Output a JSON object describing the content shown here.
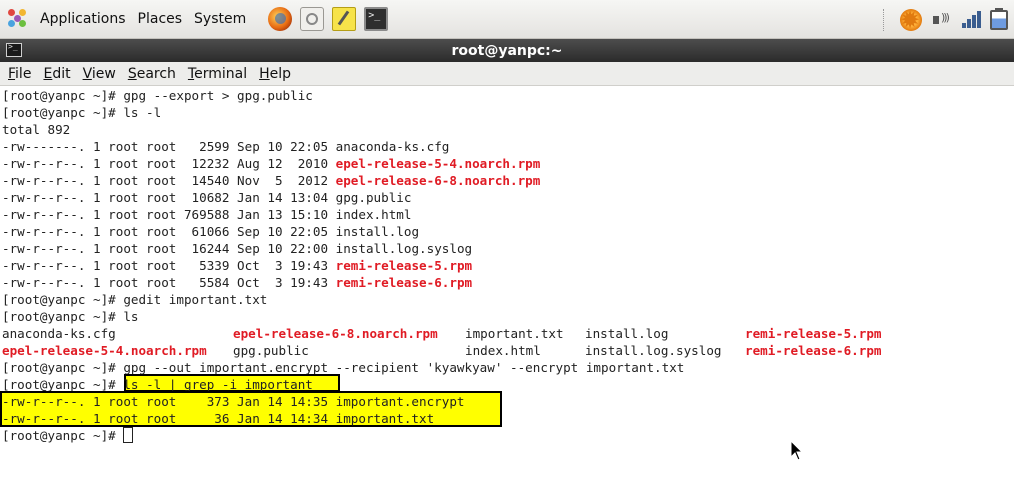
{
  "panel": {
    "menus": [
      "Applications",
      "Places",
      "System"
    ]
  },
  "window": {
    "title": "root@yanpc:~"
  },
  "menubar": {
    "items": [
      {
        "label": "File",
        "mnemonic": "F",
        "rest": "ile"
      },
      {
        "label": "Edit",
        "mnemonic": "E",
        "rest": "dit"
      },
      {
        "label": "View",
        "mnemonic": "V",
        "rest": "iew"
      },
      {
        "label": "Search",
        "mnemonic": "S",
        "rest": "earch"
      },
      {
        "label": "Terminal",
        "mnemonic": "T",
        "rest": "erminal"
      },
      {
        "label": "Help",
        "mnemonic": "H",
        "rest": "elp"
      }
    ]
  },
  "terminal": {
    "lines": [
      "[root@yanpc ~]# gpg --export > gpg.public",
      "[root@yanpc ~]# ls -l",
      "total 892"
    ],
    "ls_long": [
      {
        "meta": "-rw-------. 1 root root   2599 Sep 10 22:05 ",
        "name": "anaconda-ks.cfg",
        "red": false
      },
      {
        "meta": "-rw-r--r--. 1 root root  12232 Aug 12  2010 ",
        "name": "epel-release-5-4.noarch.rpm",
        "red": true
      },
      {
        "meta": "-rw-r--r--. 1 root root  14540 Nov  5  2012 ",
        "name": "epel-release-6-8.noarch.rpm",
        "red": true
      },
      {
        "meta": "-rw-r--r--. 1 root root  10682 Jan 14 13:04 ",
        "name": "gpg.public",
        "red": false
      },
      {
        "meta": "-rw-r--r--. 1 root root 769588 Jan 13 15:10 ",
        "name": "index.html",
        "red": false
      },
      {
        "meta": "-rw-r--r--. 1 root root  61066 Sep 10 22:05 ",
        "name": "install.log",
        "red": false
      },
      {
        "meta": "-rw-r--r--. 1 root root  16244 Sep 10 22:00 ",
        "name": "install.log.syslog",
        "red": false
      },
      {
        "meta": "-rw-r--r--. 1 root root   5339 Oct  3 19:43 ",
        "name": "remi-release-5.rpm",
        "red": true
      },
      {
        "meta": "-rw-r--r--. 1 root root   5584 Oct  3 19:43 ",
        "name": "remi-release-6.rpm",
        "red": true
      }
    ],
    "gedit_cmd": "[root@yanpc ~]# gedit important.txt",
    "ls_cmd": "[root@yanpc ~]# ls",
    "ls_short_row1": [
      {
        "name": "anaconda-ks.cfg",
        "red": false
      },
      {
        "name": "epel-release-6-8.noarch.rpm",
        "red": true
      },
      {
        "name": "important.txt",
        "red": false
      },
      {
        "name": "install.log",
        "red": false
      },
      {
        "name": "remi-release-5.rpm",
        "red": true
      }
    ],
    "ls_short_row2": [
      {
        "name": "epel-release-5-4.noarch.rpm",
        "red": true
      },
      {
        "name": "gpg.public",
        "red": false
      },
      {
        "name": "index.html",
        "red": false
      },
      {
        "name": "install.log.syslog",
        "red": false
      },
      {
        "name": "remi-release-6.rpm",
        "red": true
      }
    ],
    "encrypt_cmd": "[root@yanpc ~]# gpg --out important.encrypt --recipient 'kyawkyaw' --encrypt important.txt",
    "grep_prompt": "[root@yanpc ~]# ",
    "grep_cmd": "ls -l | grep -i important",
    "grep_results": [
      "-rw-r--r--. 1 root root    373 Jan 14 14:35 important.encrypt",
      "-rw-r--r--. 1 root root     36 Jan 14 14:34 important.txt"
    ],
    "final_prompt": "[root@yanpc ~]# "
  },
  "colors": {
    "executable_red": "#e01b24",
    "highlight": "#ffff00",
    "titlebar": "#3a3a3a"
  },
  "icons": [
    "applications-icon",
    "firefox-icon",
    "mail-icon",
    "notes-icon",
    "terminal-launcher-icon",
    "update-icon",
    "volume-icon",
    "network-icon",
    "battery-icon",
    "terminal-window-icon",
    "mouse-pointer-icon"
  ]
}
